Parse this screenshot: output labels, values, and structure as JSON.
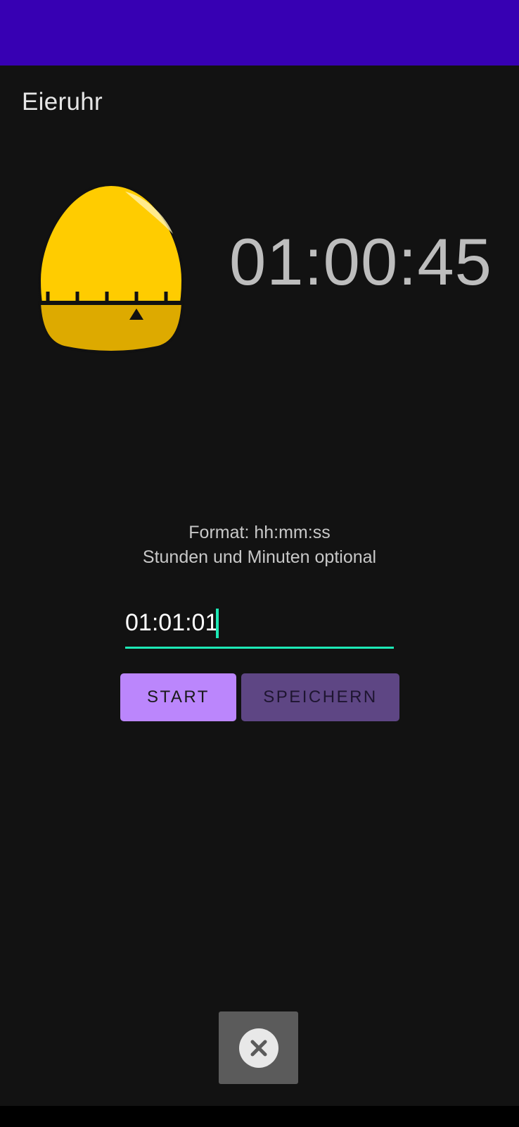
{
  "app": {
    "title": "Eieruhr"
  },
  "timer": {
    "display": "01:00:45"
  },
  "hint": {
    "line1": "Format: hh:mm:ss",
    "line2": "Stunden und Minuten optional"
  },
  "input": {
    "value": "01:01:01"
  },
  "buttons": {
    "start": "START",
    "save": "SPEICHERN"
  },
  "icons": {
    "egg": "egg-timer-icon",
    "close": "close-icon"
  },
  "colors": {
    "status_bar": "#3700B3",
    "background": "#121212",
    "accent": "#1DE9B6",
    "primary_button": "#BB86FC",
    "secondary_button": "#5E4684",
    "egg_yellow": "#FFCC00"
  }
}
